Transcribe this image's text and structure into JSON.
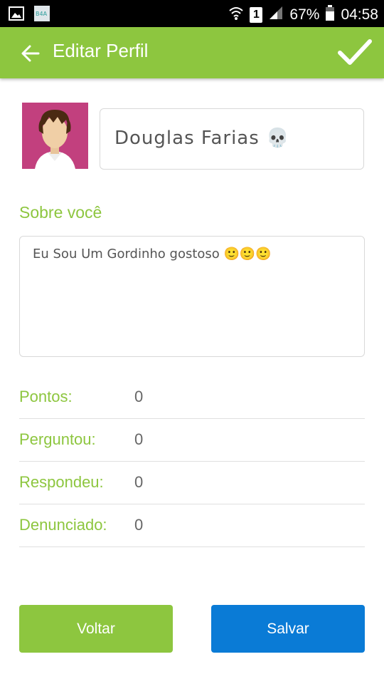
{
  "status_bar": {
    "battery": "67%",
    "time": "04:58",
    "sim_slot": "1"
  },
  "app_bar": {
    "title": "Editar Perfil",
    "color": "#8dc63f"
  },
  "profile": {
    "name": "Douglas Farias 💀",
    "about_label": "Sobre você",
    "about_text": "Eu Sou Um Gordinho gostoso 🙂🙂🙂"
  },
  "stats": [
    {
      "label": "Pontos:",
      "value": "0"
    },
    {
      "label": "Perguntou:",
      "value": "0"
    },
    {
      "label": "Respondeu:",
      "value": "0"
    },
    {
      "label": "Denunciado:",
      "value": "0"
    }
  ],
  "buttons": {
    "back_label": "Voltar",
    "save_label": "Salvar",
    "back_color": "#8dc63f",
    "save_color": "#0a7bd6"
  },
  "icons": [
    "image-icon",
    "app-logo-icon",
    "wifi-icon",
    "signal-icon",
    "battery-icon",
    "back-arrow-icon",
    "check-icon"
  ]
}
